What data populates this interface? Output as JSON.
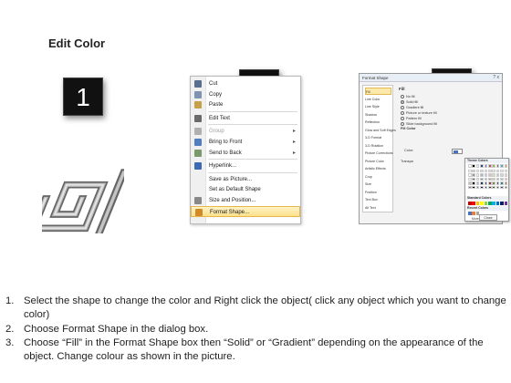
{
  "title": "Edit Color",
  "badges": [
    "1",
    "2",
    "3"
  ],
  "context_menu": {
    "items": [
      {
        "label": "Cut",
        "icon": "scissors-icon",
        "type": "item"
      },
      {
        "label": "Copy",
        "icon": "copy-icon",
        "type": "item"
      },
      {
        "label": "Paste",
        "icon": "paste-icon",
        "type": "item"
      },
      {
        "type": "sep"
      },
      {
        "label": "Edit Text",
        "icon": "edit-text-icon",
        "type": "item"
      },
      {
        "type": "sep"
      },
      {
        "label": "Group",
        "icon": "group-icon",
        "type": "item",
        "disabled": true,
        "submenu": true
      },
      {
        "label": "Bring to Front",
        "icon": "bring-front-icon",
        "type": "item",
        "submenu": true
      },
      {
        "label": "Send to Back",
        "icon": "send-back-icon",
        "type": "item",
        "submenu": true
      },
      {
        "type": "sep"
      },
      {
        "label": "Hyperlink...",
        "icon": "hyperlink-icon",
        "type": "item"
      },
      {
        "type": "sep"
      },
      {
        "label": "Save as Picture...",
        "icon": "",
        "type": "item"
      },
      {
        "label": "Set as Default Shape",
        "icon": "",
        "type": "item"
      },
      {
        "label": "Size and Position...",
        "icon": "size-position-icon",
        "type": "item"
      },
      {
        "label": "Format Shape...",
        "icon": "format-shape-icon",
        "type": "item",
        "highlight": true
      }
    ]
  },
  "dialog": {
    "title": "Format Shape",
    "close": "?  x",
    "nav": [
      "Fill",
      "Line Color",
      "Line Style",
      "Shadow",
      "Reflection",
      "Glow and Soft Edges",
      "3-D Format",
      "3-D Rotation",
      "Picture Corrections",
      "Picture Color",
      "Artistic Effects",
      "Crop",
      "Size",
      "Position",
      "Text Box",
      "Alt Text"
    ],
    "pane_heading": "Fill",
    "options": [
      "No fill",
      "Solid fill",
      "Gradient fill",
      "Picture or texture fill",
      "Pattern fill",
      "Slide background fill"
    ],
    "selected_option": 1,
    "fill_color_label": "Fill Color",
    "color_label": "Color:",
    "transparency_label": "Transpa",
    "theme_colors_label": "Theme Colors",
    "standard_colors_label": "Standard Colors",
    "recent_colors_label": "Recent Colors",
    "more_colors_label": "More Colors...",
    "close_button": "Close"
  },
  "instructions": [
    {
      "num": "1.",
      "text": "Select the shape to change the color and Right click the object( click any object which you want to change color)"
    },
    {
      "num": "2.",
      "text": "Choose Format Shape in the dialog box."
    },
    {
      "num": "3.",
      "text": "Choose “Fill” in the Format Shape box then “Solid” or “Gradient” depending on the appearance of the object. Change colour as shown in the picture."
    }
  ],
  "colors": {
    "badge_bg": "#111111",
    "menu_highlight": "#fde08a",
    "radio_selected": "#2a6bd1"
  }
}
